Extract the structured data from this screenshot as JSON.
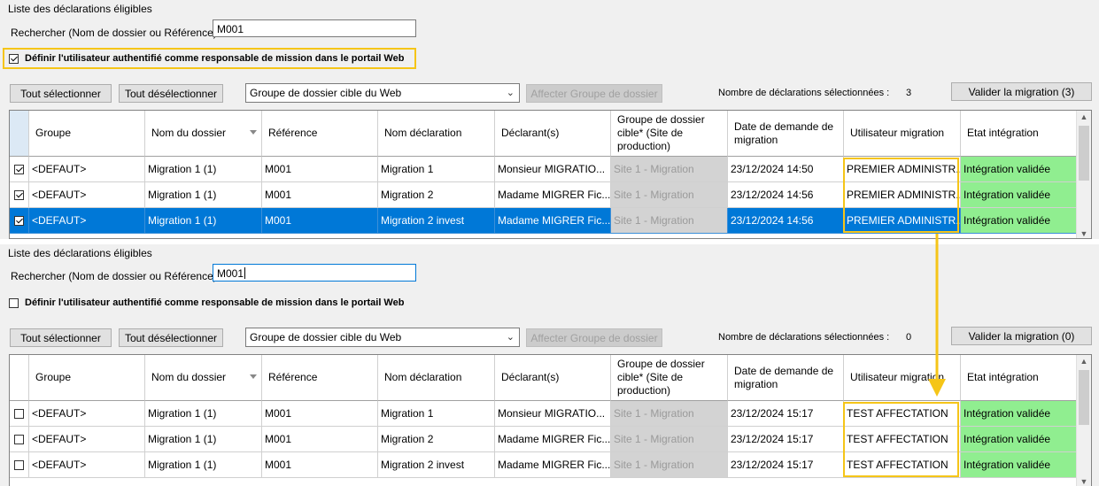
{
  "top": {
    "title": "Liste des déclarations éligibles",
    "search_label": "Rechercher (Nom de dossier ou Référence)",
    "search_value": "M001",
    "checkbox_label": "Définir l'utilisateur authentifié comme responsable de mission dans le portail Web",
    "checkbox_checked": true,
    "select_all": "Tout sélectionner",
    "deselect_all": "Tout désélectionner",
    "group_select": "Groupe de dossier cible du Web",
    "assign_button": "Affecter Groupe de dossier",
    "count_label": "Nombre de déclarations sélectionnées :",
    "count_value": "3",
    "validate_button": "Valider la migration (3)",
    "rows": [
      {
        "checked": true,
        "groupe": "<DEFAUT>",
        "nom": "Migration 1 (1)",
        "ref": "M001",
        "declaration": "Migration 1",
        "declarant": "Monsieur MIGRATIO...",
        "site": "Site 1 - Migration",
        "date": "23/12/2024 14:50",
        "user": "PREMIER ADMINISTR...",
        "etat": "Intégration validée"
      },
      {
        "checked": true,
        "groupe": "<DEFAUT>",
        "nom": "Migration 1 (1)",
        "ref": "M001",
        "declaration": "Migration 2",
        "declarant": "Madame MIGRER Fic...",
        "site": "Site 1 - Migration",
        "date": "23/12/2024 14:56",
        "user": "PREMIER ADMINISTR...",
        "etat": "Intégration validée"
      },
      {
        "checked": true,
        "groupe": "<DEFAUT>",
        "nom": "Migration 1 (1)",
        "ref": "M001",
        "declaration": "Migration 2 invest",
        "declarant": "Madame MIGRER Fic...",
        "site": "Site 1 - Migration",
        "date": "23/12/2024 14:56",
        "user": "PREMIER ADMINISTR...",
        "etat": "Intégration validée"
      }
    ]
  },
  "bottom": {
    "title": "Liste des déclarations éligibles",
    "search_label": "Rechercher (Nom de dossier ou Référence)",
    "search_value": "M001",
    "checkbox_label": "Définir l'utilisateur authentifié comme responsable de mission dans le portail Web",
    "checkbox_checked": false,
    "select_all": "Tout sélectionner",
    "deselect_all": "Tout désélectionner",
    "group_select": "Groupe de dossier cible du Web",
    "assign_button": "Affecter Groupe de dossier",
    "count_label": "Nombre de déclarations sélectionnées :",
    "count_value": "0",
    "validate_button": "Valider la migration (0)",
    "rows": [
      {
        "checked": false,
        "groupe": "<DEFAUT>",
        "nom": "Migration 1 (1)",
        "ref": "M001",
        "declaration": "Migration 1",
        "declarant": "Monsieur MIGRATIO...",
        "site": "Site 1 - Migration",
        "date": "23/12/2024 15:17",
        "user": "TEST AFFECTATION",
        "etat": "Intégration validée"
      },
      {
        "checked": false,
        "groupe": "<DEFAUT>",
        "nom": "Migration 1 (1)",
        "ref": "M001",
        "declaration": "Migration 2",
        "declarant": "Madame MIGRER Fic...",
        "site": "Site 1 - Migration",
        "date": "23/12/2024 15:17",
        "user": "TEST AFFECTATION",
        "etat": "Intégration validée"
      },
      {
        "checked": false,
        "groupe": "<DEFAUT>",
        "nom": "Migration 1 (1)",
        "ref": "M001",
        "declaration": "Migration 2 invest",
        "declarant": "Madame MIGRER Fic...",
        "site": "Site 1 - Migration",
        "date": "23/12/2024 15:17",
        "user": "TEST AFFECTATION",
        "etat": "Intégration validée"
      }
    ]
  },
  "columns": {
    "groupe": "Groupe",
    "nom": "Nom du dossier",
    "ref": "Référence",
    "declaration": "Nom déclaration",
    "declarant": "Déclarant(s)",
    "site": "Groupe de dossier cible* (Site de production)",
    "date": "Date de demande de migration",
    "user": "Utilisateur migration",
    "etat": "Etat intégration"
  },
  "colors": {
    "highlight": "#f5c518",
    "selection": "#0078d7",
    "valid": "#90ee90"
  },
  "icons": {
    "scroll_up": "chevron-up-icon",
    "scroll_down": "chevron-down-icon",
    "arrow": "down-arrow-icon"
  }
}
